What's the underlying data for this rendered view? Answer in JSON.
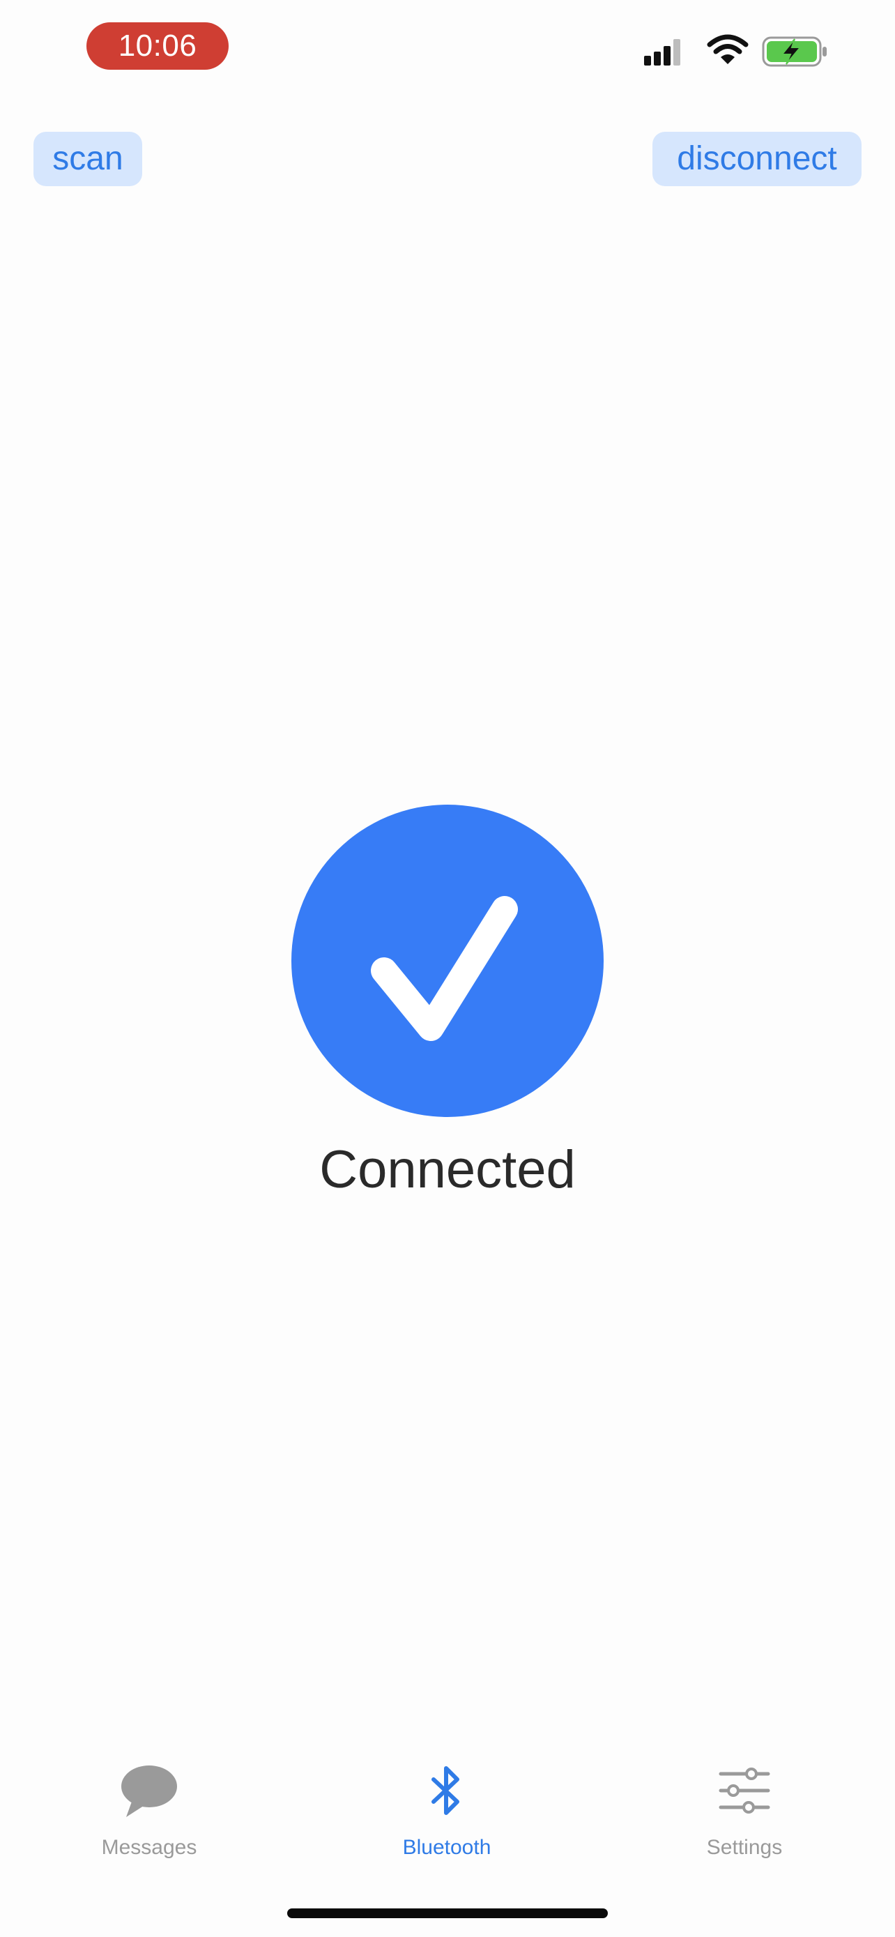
{
  "status_bar": {
    "time": "10:06",
    "time_pill_color": "#cf3e33",
    "icons": [
      "cellular-signal-icon",
      "wifi-icon",
      "battery-charging-icon"
    ],
    "battery_color": "#5ac84d"
  },
  "toolbar": {
    "scan_label": "scan",
    "disconnect_label": "disconnect",
    "button_bg_color": "#d6e6fd",
    "button_text_color": "#2f7be6"
  },
  "connection": {
    "status_icon": "checkmark-circle-icon",
    "status_text": "Connected",
    "accent_color": "#377cf6"
  },
  "tab_bar": {
    "active_color": "#2f7be6",
    "inactive_color": "#9a9a9a",
    "tabs": [
      {
        "label": "Messages",
        "icon": "speech-bubble-icon",
        "active": false
      },
      {
        "label": "Bluetooth",
        "icon": "bluetooth-icon",
        "active": true
      },
      {
        "label": "Settings",
        "icon": "sliders-icon",
        "active": false
      }
    ]
  }
}
